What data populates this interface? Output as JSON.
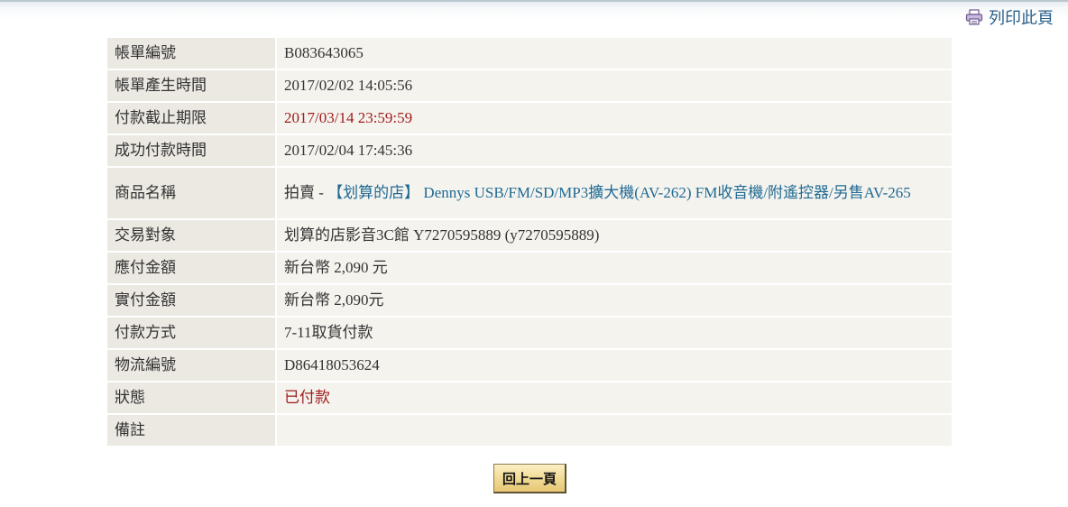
{
  "print_label": "列印此頁",
  "rows": [
    {
      "label": "帳單編號",
      "value": "B083643065"
    },
    {
      "label": "帳單產生時間",
      "value": "2017/02/02 14:05:56"
    },
    {
      "label": "付款截止期限",
      "value": "2017/03/14 23:59:59"
    },
    {
      "label": "成功付款時間",
      "value": "2017/02/04 17:45:36"
    },
    {
      "label": "商品名稱",
      "value_prefix": "拍賣 - ",
      "value_link": "【划算的店】 Dennys USB/FM/SD/MP3擴大機(AV-262) FM收音機/附遙控器/另售AV-265"
    },
    {
      "label": "交易對象",
      "value": "划算的店影音3C館 Y7270595889 (y7270595889)"
    },
    {
      "label": "應付金額",
      "value": "新台幣 2,090 元"
    },
    {
      "label": "實付金額",
      "value": "新台幣 2,090元"
    },
    {
      "label": "付款方式",
      "value": "7-11取貨付款"
    },
    {
      "label": "物流編號",
      "value": "D86418053624"
    },
    {
      "label": "狀態",
      "value": "已付款"
    },
    {
      "label": "備註",
      "value": ""
    }
  ],
  "back_button_label": "回上一頁",
  "colors": {
    "label_bg": "#ece9e2",
    "value_bg": "#f4f3ee",
    "deadline_red": "#a01d1d",
    "link_blue": "#1f6a94",
    "button_gold": "#f0d993"
  },
  "icons": {
    "print": "printer-icon"
  }
}
